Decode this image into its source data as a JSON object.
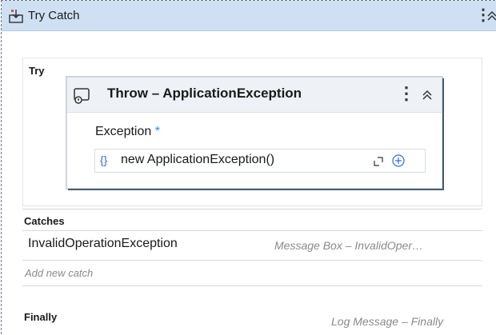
{
  "try_catch": {
    "title": "Try Catch",
    "icons": {
      "activity": "try-catch-icon",
      "menu": "kebab-menu-icon",
      "collapse": "chevron-up-double-icon"
    }
  },
  "try_section": {
    "label": "Try",
    "throw_activity": {
      "title": "Throw – ApplicationException",
      "icons": {
        "activity": "throw-icon",
        "menu": "kebab-menu-icon",
        "collapse": "chevron-up-double-icon"
      },
      "exception_label": "Exception",
      "required_marker": "*",
      "expression_prefix": "{}",
      "expression_value": "new ApplicationException()",
      "expression_icons": {
        "expand": "expand-editor-icon",
        "add": "plus-circle-icon"
      }
    }
  },
  "catches_section": {
    "label": "Catches",
    "items": [
      {
        "exception": "InvalidOperationException",
        "action": "Message Box – InvalidOper…"
      }
    ],
    "add_label": "Add new catch"
  },
  "finally_section": {
    "label": "Finally",
    "action": "Log Message – Finally"
  },
  "colors": {
    "header_bg": "#cfe0f2",
    "accent": "#1e90ff",
    "muted_text": "#8a8a8a"
  }
}
